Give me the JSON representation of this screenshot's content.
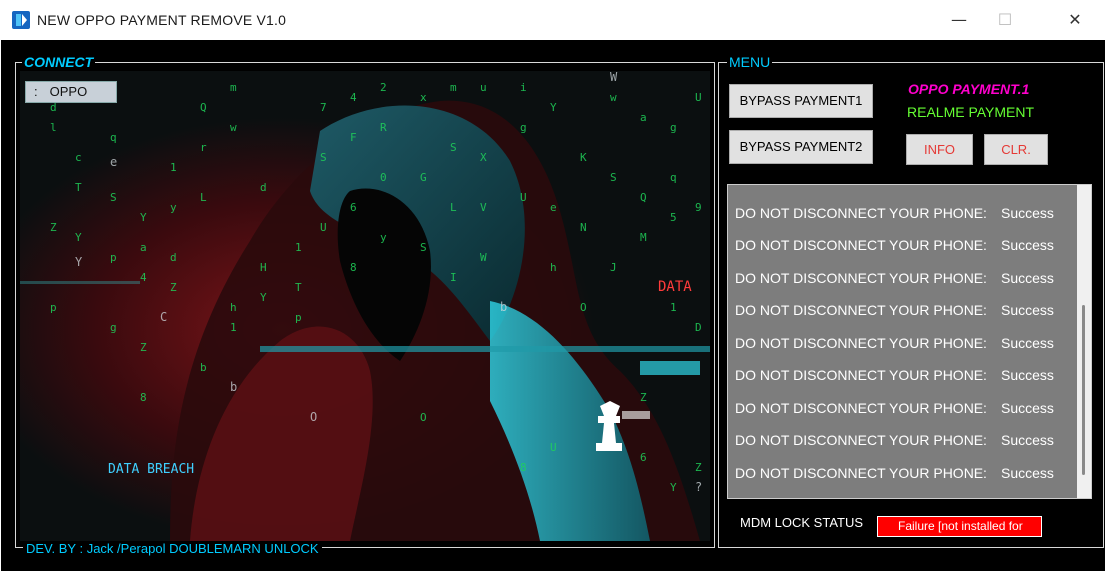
{
  "window": {
    "title": "NEW OPPO PAYMENT REMOVE V1.0",
    "minimize_glyph": "—",
    "maximize_glyph": "☐",
    "close_glyph": "✕"
  },
  "connect": {
    "legend": "CONNECT",
    "device_button": {
      "prefix": ":",
      "label": "OPPO"
    },
    "footer": "DEV. BY : Jack /Perapol  DOUBLEMARN UNLOCK"
  },
  "menu": {
    "legend": "MENU",
    "bypass_payment1": "BYPASS PAYMENT1",
    "bypass_payment2": "BYPASS PAYMENT2",
    "oppo_payment_label": "OPPO  PAYMENT.1",
    "realme_payment_label": "REALME PAYMENT",
    "info_button": "INFO",
    "clear_button": "CLR.",
    "log": [
      {
        "message": "DO NOT DISCONNECT YOUR PHONE",
        "separator": ":",
        "status": "Success"
      },
      {
        "message": "DO NOT DISCONNECT YOUR PHONE",
        "separator": ":",
        "status": "Success"
      },
      {
        "message": "DO NOT DISCONNECT YOUR PHONE",
        "separator": ":",
        "status": "Success"
      },
      {
        "message": "DO NOT DISCONNECT YOUR PHONE",
        "separator": ":",
        "status": "Success"
      },
      {
        "message": "DO NOT DISCONNECT YOUR PHONE",
        "separator": ":",
        "status": "Success"
      },
      {
        "message": "DO NOT DISCONNECT YOUR PHONE",
        "separator": ":",
        "status": "Success"
      },
      {
        "message": "DO NOT DISCONNECT YOUR PHONE",
        "separator": ":",
        "status": "Success"
      },
      {
        "message": "DO NOT DISCONNECT YOUR PHONE",
        "separator": ":",
        "status": "Success"
      },
      {
        "message": "DO NOT DISCONNECT YOUR PHONE",
        "separator": ":",
        "status": "Success"
      }
    ],
    "mdm_lock_label": "MDM LOCK STATUS",
    "mdm_lock_value": "Failure  [not installed for"
  },
  "image_text": {
    "breach": "DATA BREACH",
    "data": "DATA"
  },
  "colors": {
    "accent_cyan": "#00ccff",
    "oppo_magenta": "#ff00cc",
    "realme_green": "#66ff33",
    "button_red_text": "#e53935",
    "mdm_failure_red": "#ff0000",
    "log_background": "#7d7d7d"
  },
  "icons": {
    "app": "app-logo-icon"
  }
}
